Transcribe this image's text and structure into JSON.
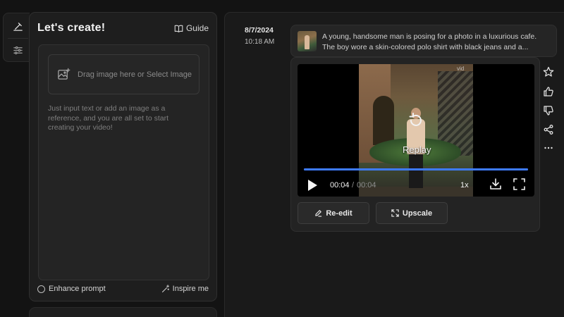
{
  "panel": {
    "title": "Let's create!",
    "guide_label": "Guide",
    "upload_label": "Drag image here or Select Image",
    "hint": "Just input text or add an image as a reference, and you are all set to start creating your video!",
    "enhance_label": "Enhance prompt",
    "inspire_label": "Inspire me"
  },
  "history": {
    "date": "8/7/2024",
    "time": "10:18 AM",
    "prompt": "A young, handsome man is posing for a photo in a luxurious cafe. The boy wore a skin-colored polo shirt with black jeans and a..."
  },
  "player": {
    "watermark": "vid",
    "replay_label": "Replay",
    "current_time": "00:04",
    "separator": "/",
    "total_time": "00:04",
    "speed": "1x",
    "progress": 1.0
  },
  "actions": {
    "reedit_label": "Re-edit",
    "upscale_label": "Upscale"
  },
  "colors": {
    "accent": "#3e7bff",
    "background": "#131313",
    "panel": "#1e1e1e"
  },
  "icons": {
    "rail": [
      "brush-icon",
      "sliders-icon"
    ],
    "side_tools": [
      "star-icon",
      "thumbs-up-icon",
      "thumbs-down-icon",
      "share-icon",
      "more-icon"
    ]
  }
}
